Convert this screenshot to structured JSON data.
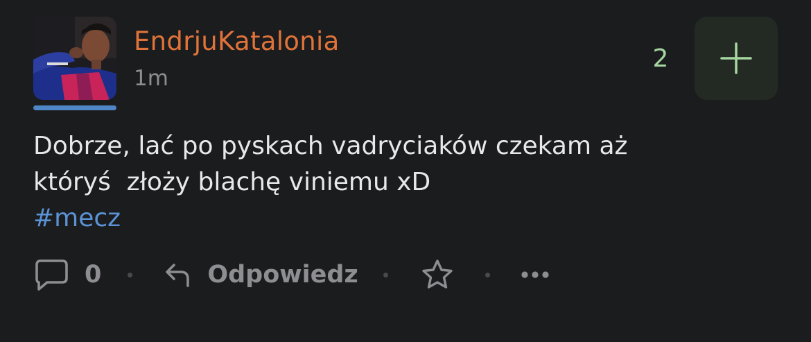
{
  "post": {
    "author": "EndrjuKatalonia",
    "time": "1m",
    "vote_count": "2",
    "body_line_1": "Dobrze, lać po pyskach vadryciaków czekam aż",
    "body_line_2": "któryś  złoży blachę viniemu xD",
    "hashtag": "#mecz"
  },
  "actions": {
    "comment_count": "0",
    "reply_label": "Odpowiedz"
  },
  "icons": {
    "comment": "comment-icon",
    "reply": "reply-arrow-icon",
    "favorite": "star-icon",
    "more": "more-horizontal-icon",
    "upvote": "plus-icon"
  },
  "colors": {
    "background": "#1b1c1e",
    "author": "#e0733a",
    "hashtag": "#5b93d6",
    "vote": "#a6d6a0",
    "underline": "#4f86c6"
  }
}
